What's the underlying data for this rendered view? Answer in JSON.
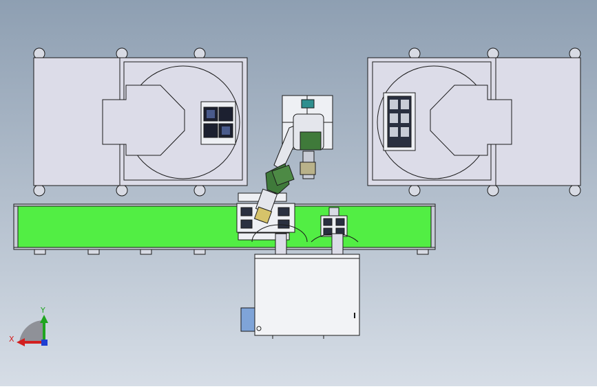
{
  "axes": {
    "x_label": "X",
    "y_label": "Y"
  },
  "colors": {
    "bg_top": "#8e9fb2",
    "bg_bottom": "#d6dde6",
    "machine_fill": "#dcdce8",
    "line": "#1a1a1a",
    "conveyor_green": "#52ee44",
    "robot_green": "#3f7a3a",
    "axis_x": "#d21f1f",
    "axis_y": "#1fa51f",
    "axis_z": "#1f3fd2"
  }
}
